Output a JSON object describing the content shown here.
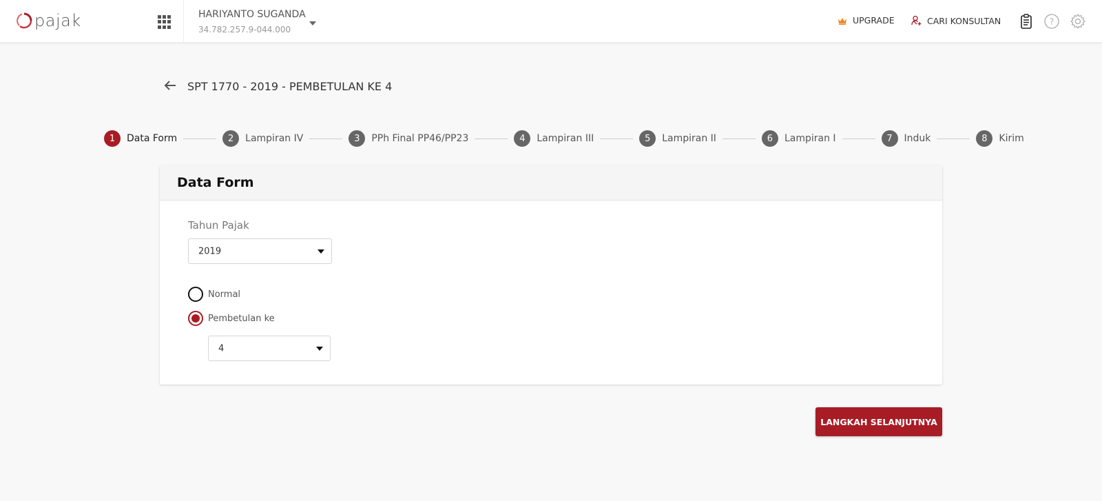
{
  "brand": {
    "name": "pajak",
    "accent": "#a71c25"
  },
  "header": {
    "user_name": "HARIYANTO SUGANDA",
    "user_npwp": "34.782.257.9-044.000",
    "upgrade_label": "UPGRADE",
    "konsultan_label": "CARI KONSULTAN",
    "icons": [
      "apps-grid-icon",
      "crown-icon",
      "consultant-icon",
      "clipboard-icon",
      "help-icon",
      "gear-icon"
    ]
  },
  "page": {
    "title": "SPT 1770 - 2019 - PEMBETULAN KE 4"
  },
  "stepper": {
    "active_index": 0,
    "steps": [
      {
        "num": "1",
        "label": "Data Form"
      },
      {
        "num": "2",
        "label": "Lampiran IV"
      },
      {
        "num": "3",
        "label": "PPh Final PP46/PP23"
      },
      {
        "num": "4",
        "label": "Lampiran III"
      },
      {
        "num": "5",
        "label": "Lampiran II"
      },
      {
        "num": "6",
        "label": "Lampiran I"
      },
      {
        "num": "7",
        "label": "Induk"
      },
      {
        "num": "8",
        "label": "Kirim"
      }
    ]
  },
  "form": {
    "card_title": "Data Form",
    "tahun_label": "Tahun Pajak",
    "tahun_value": "2019",
    "radio_normal_label": "Normal",
    "radio_pembetulan_label": "Pembetulan ke",
    "selected_type": "pembetulan",
    "pembetulan_value": "4"
  },
  "actions": {
    "next_label": "LANGKAH SELANJUTNYA"
  }
}
